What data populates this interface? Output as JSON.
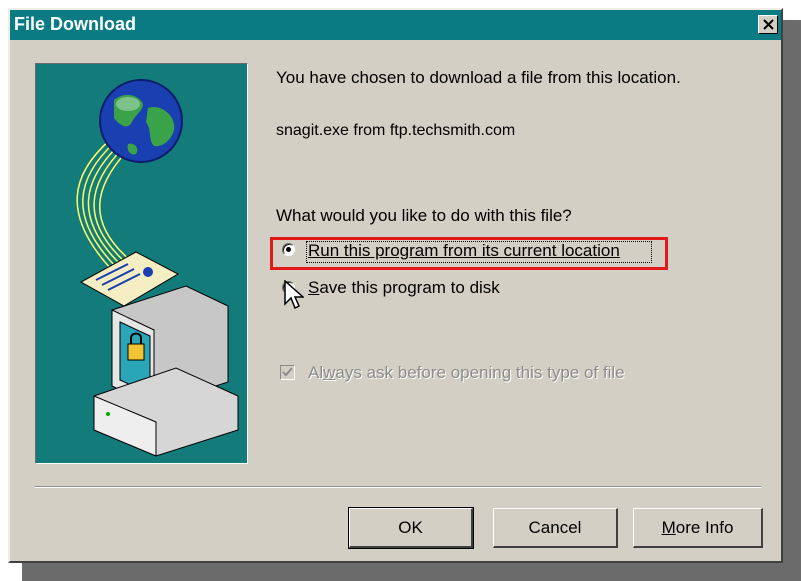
{
  "dialog": {
    "title": "File Download",
    "message": "You have chosen to download a file from this location.",
    "file_info": "snagit.exe from ftp.techsmith.com",
    "question": "What would you like to do with this file?",
    "options": [
      {
        "label": "Run this program from its current location",
        "selected": true
      },
      {
        "label_before": "",
        "label_u": "S",
        "label_after": "ave this program to disk",
        "selected": false
      }
    ],
    "always_ask": {
      "before": "Al",
      "u": "w",
      "after": "ays ask before opening this type of file",
      "checked": true,
      "disabled": true
    },
    "buttons": {
      "ok": "OK",
      "cancel": "Cancel",
      "more_info_u": "M",
      "more_info_rest": "ore Info"
    }
  },
  "colors": {
    "titlebar": "#0a7b83",
    "dialog_bg": "#d4cfc4",
    "illustration_bg": "#137c7b",
    "highlight": "#e01818"
  },
  "icons": [
    "close-icon",
    "globe-icon",
    "document-icon",
    "computer-lock-icon",
    "mouse-cursor-icon",
    "checkmark-icon"
  ]
}
